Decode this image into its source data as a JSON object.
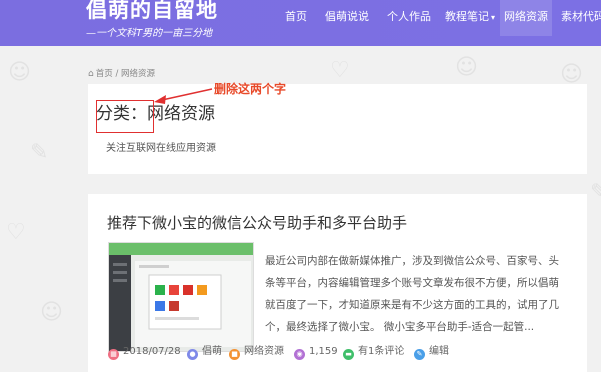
{
  "header": {
    "site_title": "倡萌的自留地",
    "slogan": "—一个文科T男的一亩三分地",
    "nav": [
      {
        "label": "首页"
      },
      {
        "label": "倡萌说说"
      },
      {
        "label": "个人作品"
      },
      {
        "label": "教程笔记"
      },
      {
        "label": "网络资源",
        "active": true
      },
      {
        "label": "素材代码"
      }
    ]
  },
  "breadcrumb": {
    "home": "首页",
    "separator": "/",
    "current": "网络资源"
  },
  "category": {
    "title": "分类：网络资源",
    "description": "关注互联网在线应用资源"
  },
  "annotation": {
    "text": "删除这两个字"
  },
  "post": {
    "title": "推荐下微小宝的微信公众号助手和多平台助手",
    "excerpt": "最近公司内部在做新媒体推广，涉及到微信公众号、百家号、头条等平台，内容编辑管理多个账号文章发布很不方便，所以倡萌就百度了一下，才知道原来是有不少这方面的工具的，试用了几个，最终选择了微小宝。 微小宝多平台助手-适合一起管...",
    "meta": {
      "date": "2018/07/28",
      "author": "倡萌",
      "category": "网络资源",
      "views": "1,159",
      "comments": "有1条评论",
      "edit": "编辑"
    }
  },
  "colors": {
    "header_bg": "#7b6ee0",
    "annotation": "#e84a2a",
    "annotation_box": "#e03030"
  }
}
